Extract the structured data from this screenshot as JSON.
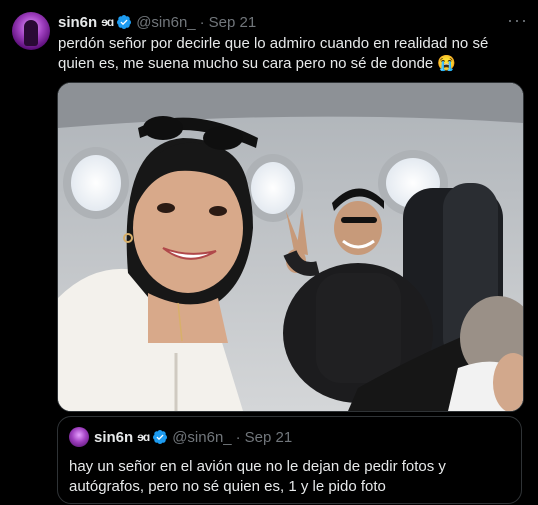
{
  "tweet": {
    "author_name": "sin6n",
    "author_name_emoji": "ɘɑ",
    "handle": "@sin6n_",
    "separator": "·",
    "date": "Sep 21",
    "more_label": "···",
    "text": "perdón señor por decirle que lo admiro cuando en realidad no sé quien es, me suena mucho su cara pero no sé de donde 😭"
  },
  "quoted_tweet": {
    "author_name": "sin6n",
    "author_name_emoji": "ɘɑ",
    "handle": "@sin6n_",
    "separator": "·",
    "date": "Sep 21",
    "text": "hay un señor en el avión que no le dejan de pedir fotos y autógrafos, pero no sé quien es, 1 y le pido foto"
  },
  "colors": {
    "background": "#000000",
    "text": "#e7e9ea",
    "muted": "#71767b",
    "border": "#2f3336",
    "verified": "#1d9bf0"
  }
}
